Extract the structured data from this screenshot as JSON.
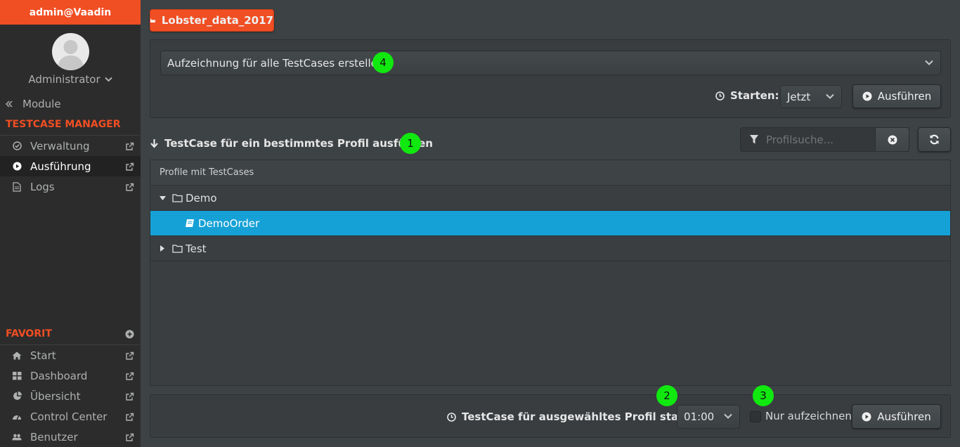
{
  "user": {
    "title": "admin@Vaadin",
    "role": "Administrator"
  },
  "nav": {
    "module_label": "Module",
    "section_testcase": "TESTCASE MANAGER",
    "testcase_items": [
      {
        "label": "Verwaltung",
        "icon": "check-circle-icon"
      },
      {
        "label": "Ausführung",
        "icon": "play-circle-icon"
      },
      {
        "label": "Logs",
        "icon": "file-icon"
      }
    ],
    "section_favorit": "FAVORIT",
    "favorit_items": [
      {
        "label": "Start",
        "icon": "home-icon"
      },
      {
        "label": "Dashboard",
        "icon": "grid-icon"
      },
      {
        "label": "Übersicht",
        "icon": "pie-chart-icon"
      },
      {
        "label": "Control Center",
        "icon": "gauge-icon"
      },
      {
        "label": "Benutzer",
        "icon": "users-icon"
      }
    ]
  },
  "header": {
    "project_button": "Lobster_data_2017"
  },
  "recording": {
    "combo_value": "Aufzeichnung für alle TestCases erstellen",
    "badge": "4",
    "start_label": "Starten:",
    "start_value": "Jetzt",
    "execute_label": "Ausführen"
  },
  "profile": {
    "section_title": "TestCase für ein bestimmtes Profil ausführen",
    "badge": "1",
    "search_placeholder": "Profilsuche...",
    "tree_header": "Profile mit TestCases",
    "tree": [
      {
        "label": "Demo",
        "expanded": true,
        "level": 0
      },
      {
        "label": "DemoOrder",
        "level": 1,
        "selected": true
      },
      {
        "label": "Test",
        "expanded": false,
        "level": 0
      }
    ]
  },
  "footer": {
    "start_label": "TestCase für ausgewähltes Profil starten:",
    "time_value": "01:00",
    "badge_time": "2",
    "badge_record": "3",
    "record_only_label": "Nur aufzeichnen",
    "execute_label": "Ausführen"
  },
  "colors": {
    "accent": "#f04e23",
    "selection": "#16a1d6",
    "badge": "#10e810"
  }
}
